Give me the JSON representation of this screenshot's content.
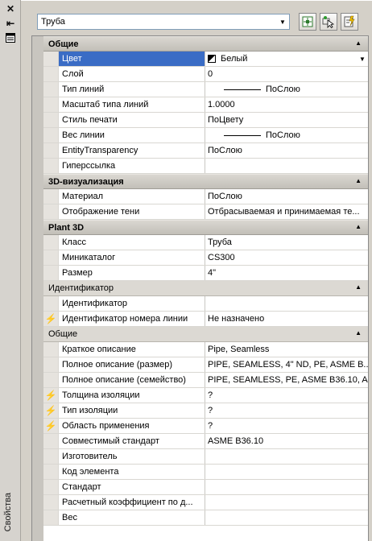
{
  "strip": {
    "title": "Свойства"
  },
  "toolbar": {
    "selector_value": "Труба"
  },
  "sections": {
    "general": {
      "title": "Общие",
      "rows": [
        {
          "name": "Цвет",
          "value": "Белый"
        },
        {
          "name": "Слой",
          "value": "0"
        },
        {
          "name": "Тип линий",
          "value": "ПоСлою"
        },
        {
          "name": "Масштаб типа линий",
          "value": "1.0000"
        },
        {
          "name": "Стиль печати",
          "value": "ПоЦвету"
        },
        {
          "name": "Вес линии",
          "value": "ПоСлою"
        },
        {
          "name": "EntityTransparency",
          "value": "ПоСлою"
        },
        {
          "name": "Гиперссылка",
          "value": ""
        }
      ]
    },
    "viz3d": {
      "title": "3D-визуализация",
      "rows": [
        {
          "name": "Материал",
          "value": "ПоСлою"
        },
        {
          "name": "Отображение тени",
          "value": "Отбрасываемая и принимаемая те..."
        }
      ]
    },
    "plant3d": {
      "title": "Plant 3D",
      "rows": [
        {
          "name": "Класс",
          "value": "Труба"
        },
        {
          "name": "Миникаталог",
          "value": "CS300"
        },
        {
          "name": "Размер",
          "value": "4\""
        }
      ]
    },
    "ident": {
      "title": "Идентификатор",
      "rows": [
        {
          "name": "Идентификатор",
          "value": ""
        },
        {
          "name": "Идентификатор номера линии",
          "value": "Не назначено"
        }
      ]
    },
    "common": {
      "title": "Общие",
      "rows": [
        {
          "name": "Краткое описание",
          "value": "Pipe, Seamless"
        },
        {
          "name": "Полное описание (размер)",
          "value": "PIPE, SEAMLESS, 4\" ND, PE, ASME B..."
        },
        {
          "name": "Полное описание (семейство)",
          "value": "PIPE, SEAMLESS, PE, ASME B36.10, A..."
        },
        {
          "name": "Толщина изоляции",
          "value": "?"
        },
        {
          "name": "Тип изоляции",
          "value": "?"
        },
        {
          "name": "Область применения",
          "value": "?"
        },
        {
          "name": "Совместимый стандарт",
          "value": "ASME B36.10"
        },
        {
          "name": "Изготовитель",
          "value": ""
        },
        {
          "name": "Код элемента",
          "value": ""
        },
        {
          "name": "Стандарт",
          "value": ""
        },
        {
          "name": "Расчетный коэффициент по д...",
          "value": ""
        },
        {
          "name": "Вес",
          "value": ""
        }
      ]
    }
  },
  "icons": {
    "close": "close-icon",
    "autohide": "autohide-icon",
    "menu": "properties-menu-icon",
    "quick_select": "quick-select-icon",
    "select_objects": "select-objects-icon",
    "toggle_pickadd": "toggle-pickadd-icon",
    "lightning": "lightning-icon"
  },
  "colors": {
    "selection": "#3a6cc5",
    "lightning": "#e8a000"
  }
}
